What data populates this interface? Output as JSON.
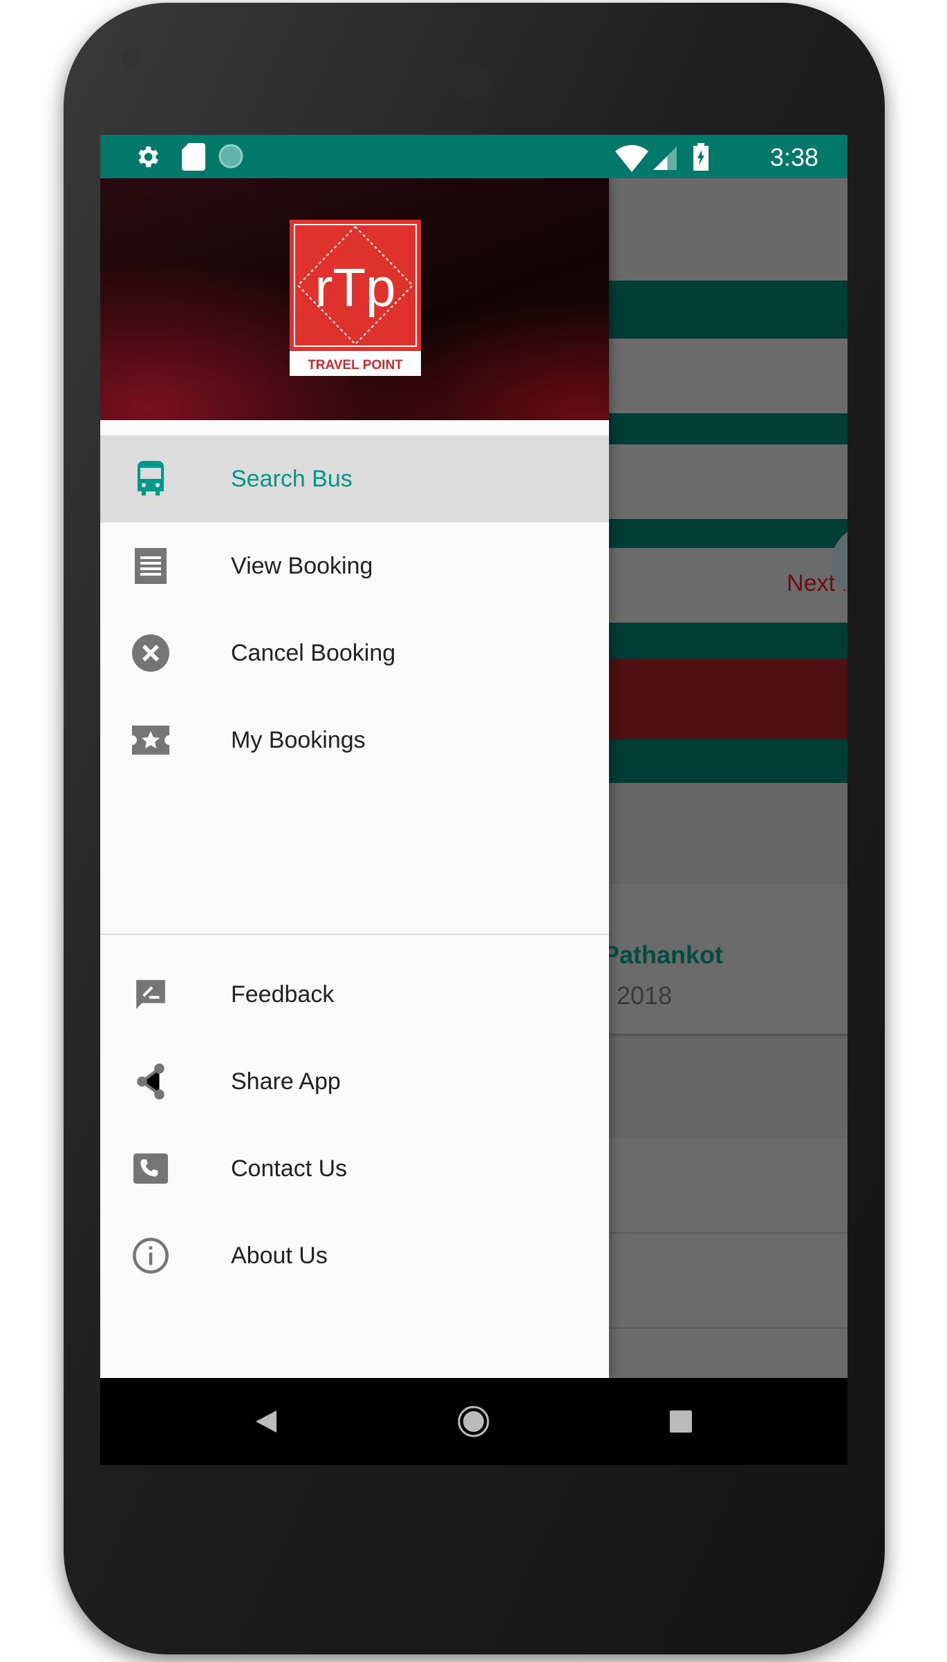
{
  "status_bar": {
    "time": "3:38",
    "left_icons": [
      "settings-icon",
      "sd-card-icon",
      "sync-icon"
    ],
    "right_icons": [
      "wifi-icon",
      "signal-icon",
      "battery-charging-icon"
    ]
  },
  "drawer": {
    "logo": {
      "text": "rTp",
      "caption": "TRAVEL POINT"
    },
    "primary_items": [
      {
        "label": "Search Bus",
        "icon": "bus-icon",
        "active": true
      },
      {
        "label": "View Booking",
        "icon": "receipt-icon"
      },
      {
        "label": "Cancel Booking",
        "icon": "cancel-icon"
      },
      {
        "label": "My Bookings",
        "icon": "ticket-star-icon"
      }
    ],
    "secondary_items": [
      {
        "label": "Feedback",
        "icon": "feedback-icon"
      },
      {
        "label": "Share App",
        "icon": "share-icon"
      },
      {
        "label": "Contact Us",
        "icon": "phone-icon"
      },
      {
        "label": "About Us",
        "icon": "info-icon"
      }
    ]
  },
  "background": {
    "next_day": "Next Day",
    "recent_city": "Pathankot",
    "recent_date": "2018"
  },
  "colors": {
    "accent": "#009688",
    "status_bar": "#00796b",
    "brand_red": "#e0322c"
  }
}
